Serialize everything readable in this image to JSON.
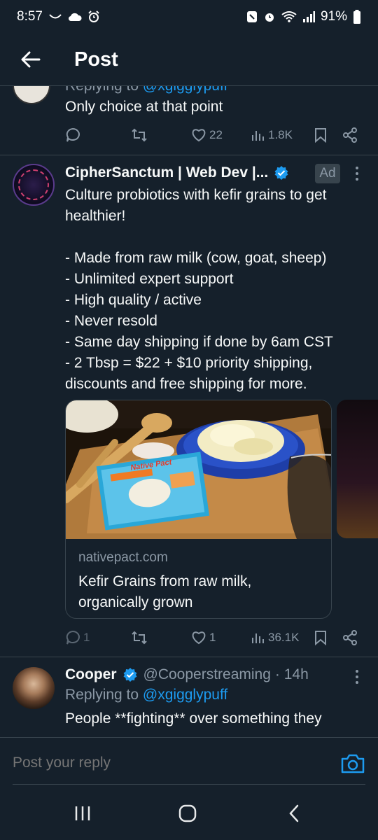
{
  "status": {
    "time": "8:57",
    "battery": "91%"
  },
  "header": {
    "title": "Post"
  },
  "tweet1": {
    "reply_prefix": "Replying to ",
    "reply_handle": "@xgigglypuff",
    "text": "Only choice at that point",
    "likes": "22",
    "views": "1.8K"
  },
  "ad": {
    "name": "CipherSanctum | Web Dev |...",
    "badge": "Ad",
    "lines": [
      "Culture probiotics with kefir grains to get",
      "healthier!",
      "",
      "- Made from raw milk (cow, goat, sheep)",
      "- Unlimited expert support",
      "- High quality / active",
      "- Never resold",
      "- Same day shipping if done by 6am CST",
      "- 2 Tbsp = $22 + $10 priority shipping,",
      "discounts and free shipping for more."
    ],
    "card": {
      "domain": "nativepact.com",
      "title": "Kefir Grains from raw milk, organically grown",
      "image_label": "Native Pact"
    },
    "replies": "1",
    "likes": "1",
    "views": "36.1K"
  },
  "tweet3": {
    "name": "Cooper",
    "handle": "@Cooperstreaming",
    "time": "· 14h",
    "reply_prefix": "Replying to ",
    "reply_handle": "@xgigglypuff",
    "text": "People **fighting** over something they"
  },
  "reply": {
    "placeholder": "Post your reply"
  },
  "colors": {
    "background": "#15202b",
    "accent": "#1d9bf0",
    "muted": "#8b98a5",
    "divider": "#38444d"
  }
}
